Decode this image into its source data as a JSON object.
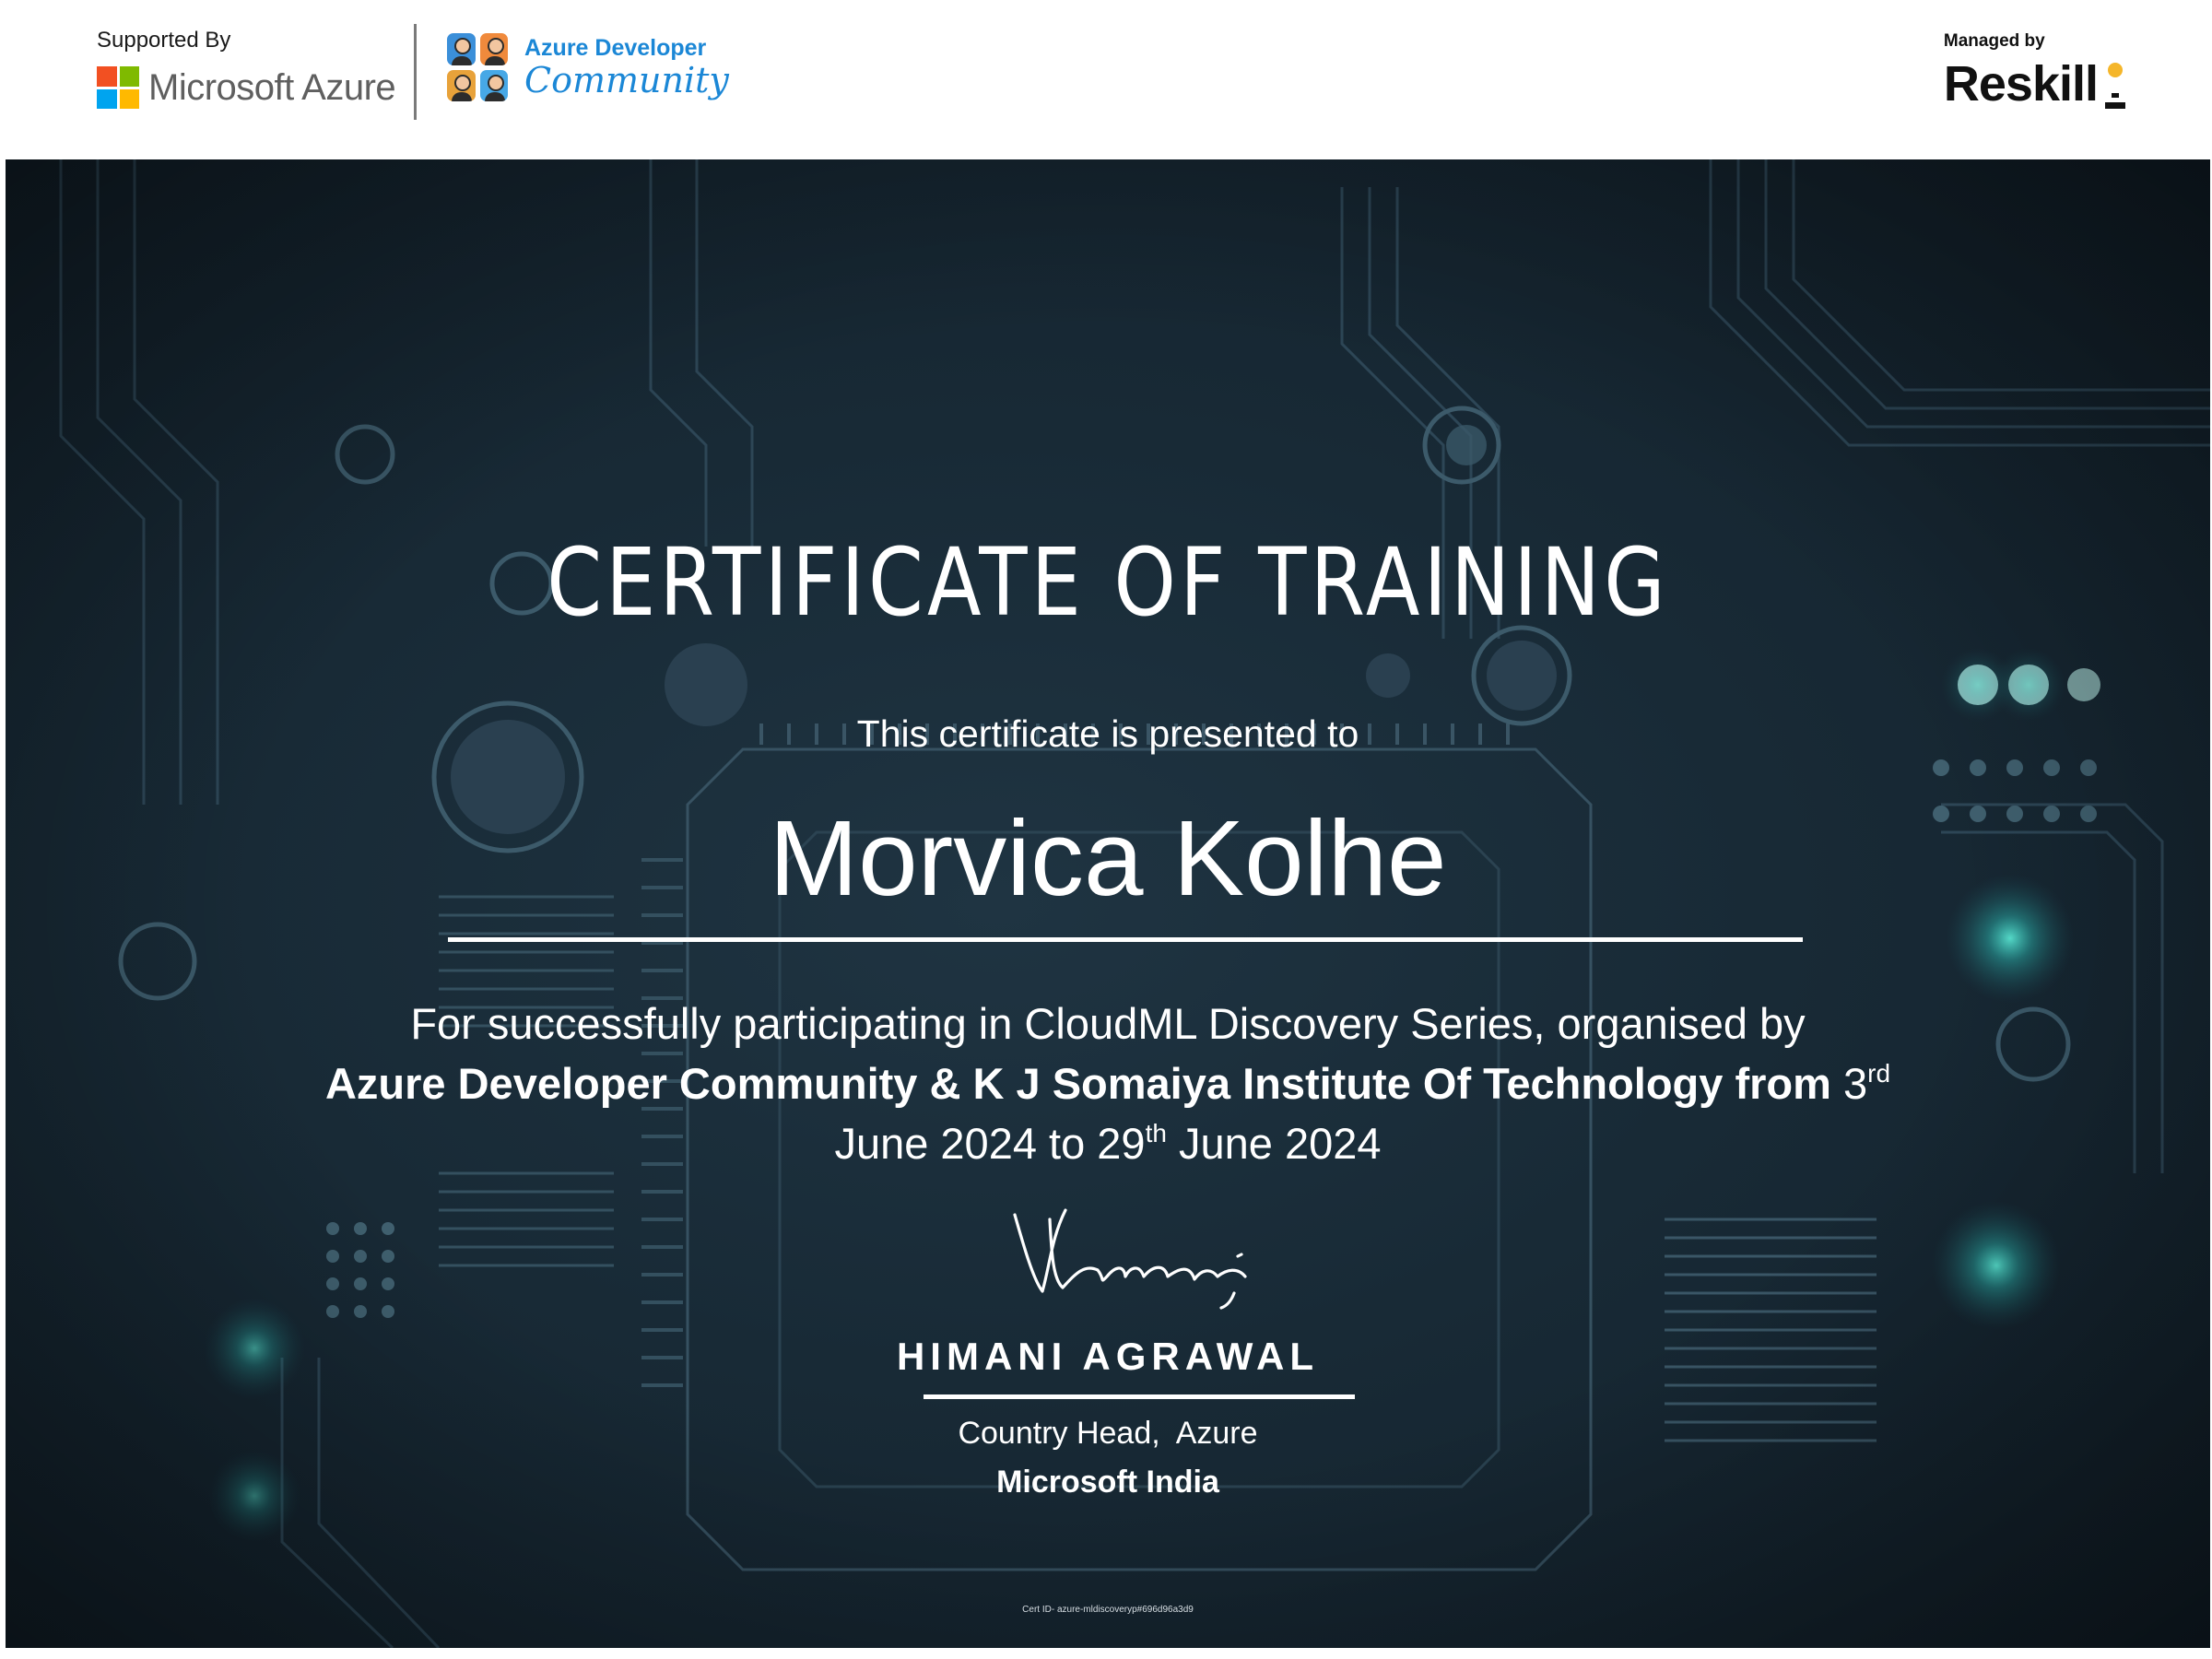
{
  "header": {
    "supported_label": "Supported By",
    "microsoft_name": "Microsoft Azure",
    "microsoft_colors": [
      "#f25022",
      "#7fba00",
      "#00a4ef",
      "#ffb900"
    ],
    "community_title": "Azure Developer",
    "community_subtitle": "Community",
    "community_avatar_colors": [
      "#3b8fd9",
      "#f08a3c",
      "#e8a23a",
      "#47a8e6"
    ],
    "managed_label": "Managed by",
    "managed_name": "Reskill"
  },
  "certificate": {
    "title": "CERTIFICATE OF TRAINING",
    "presented_to": "This certificate is presented to",
    "recipient": "Morvica Kolhe",
    "description": {
      "line1": "For successfully participating in CloudML Discovery Series, organised by",
      "org": "Azure Developer Community & K J Somaiya Institute Of Technology from",
      "start_day": "3",
      "start_suffix": "rd",
      "start_rest": "June 2024 to",
      "end_day": "29",
      "end_suffix": "th",
      "end_rest": "June 2024"
    },
    "signature_text": "Himani",
    "signer": {
      "name": "HIMANI AGRAWAL",
      "role": "Country Head,  Azure",
      "organization": "Microsoft India"
    },
    "cert_id": "Cert ID- azure-mldiscoveryp#696d96a3d9"
  },
  "colors": {
    "background": "#182a36",
    "accent_blue": "#1b87d6",
    "glow": "#3fe0d0"
  }
}
